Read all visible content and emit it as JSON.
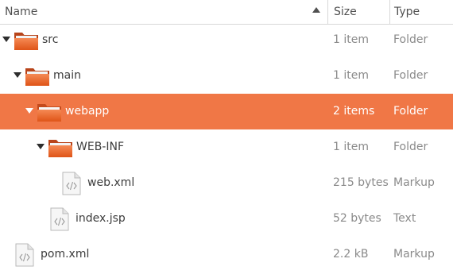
{
  "columns": {
    "name": "Name",
    "size": "Size",
    "type": "Type"
  },
  "accent": "#f07746",
  "folder_color": "#e65e24",
  "rows": [
    {
      "name": "src",
      "size": "1 item",
      "type": "Folder",
      "icon": "folder-icon",
      "expanded": true
    },
    {
      "name": "main",
      "size": "1 item",
      "type": "Folder",
      "icon": "folder-icon",
      "expanded": true
    },
    {
      "name": "webapp",
      "size": "2 items",
      "type": "Folder",
      "icon": "folder-icon",
      "expanded": true,
      "selected": true
    },
    {
      "name": "WEB-INF",
      "size": "1 item",
      "type": "Folder",
      "icon": "folder-icon",
      "expanded": true
    },
    {
      "name": "web.xml",
      "size": "215 bytes",
      "type": "Markup",
      "icon": "markup-file-icon"
    },
    {
      "name": "index.jsp",
      "size": "52 bytes",
      "type": "Text",
      "icon": "code-file-icon"
    },
    {
      "name": "pom.xml",
      "size": "2.2 kB",
      "type": "Markup",
      "icon": "markup-file-icon"
    }
  ]
}
